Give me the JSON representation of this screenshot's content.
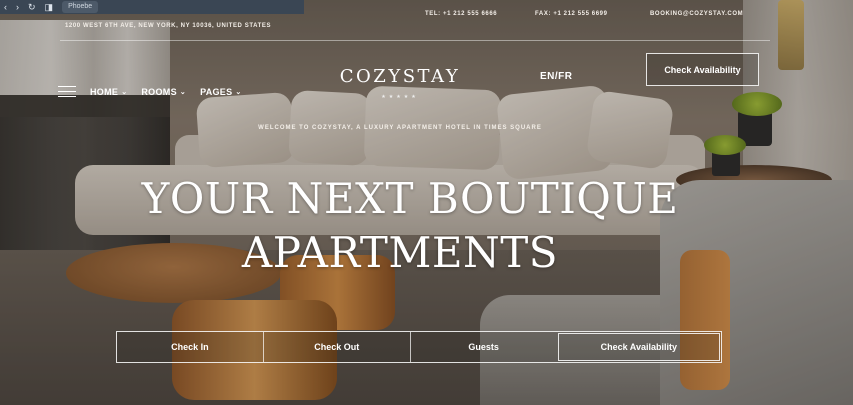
{
  "browser": {
    "back_glyph": "‹",
    "forward_glyph": "›",
    "reload_glyph": "↻",
    "bookmark_glyph": "◨",
    "tab_text": "Phoebe",
    "url_text": ""
  },
  "header": {
    "address": "1200 WEST 6TH AVE, NEW YORK, NY 10036, UNITED STATES",
    "tel": "TEL: +1 212 555 6666",
    "fax": "FAX: +1 212 555 6699",
    "email": "BOOKING@COZYSTAY.COM",
    "nav": [
      {
        "label": "HOME"
      },
      {
        "label": "ROOMS"
      },
      {
        "label": "PAGES"
      }
    ],
    "logo": "COZYSTAY",
    "stars": "★★★★★",
    "lang": "EN/FR",
    "cta_label": "Check Availability"
  },
  "hero": {
    "welcome": "WELCOME TO COZYSTAY, A LUXURY APARTMENT HOTEL IN TIMES SQUARE",
    "line1": "YOUR NEXT BOUTIQUE",
    "line2": "APARTMENTS"
  },
  "booking": {
    "check_in": "Check In",
    "check_out": "Check Out",
    "guests": "Guests",
    "submit": "Check Availability"
  },
  "icons": {
    "chevron": "⌄"
  }
}
